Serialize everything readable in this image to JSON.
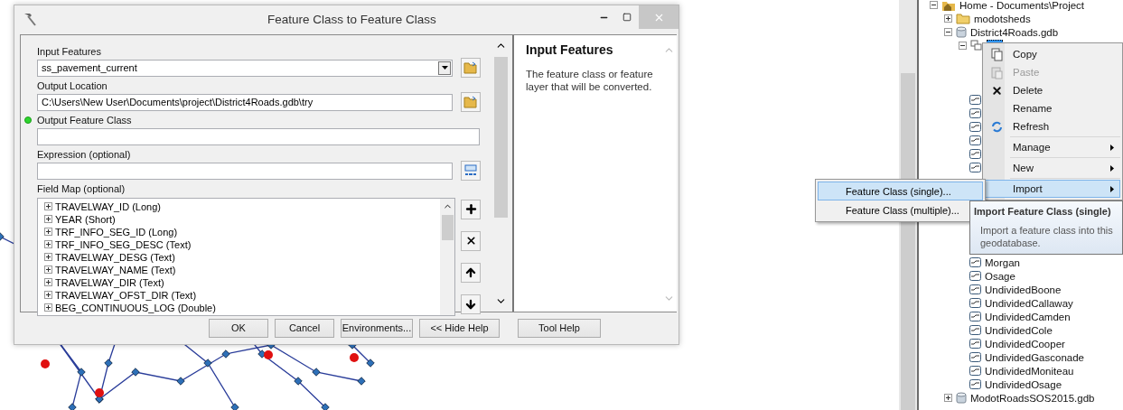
{
  "dialog": {
    "title": "Feature Class to Feature Class",
    "parameters": [
      {
        "kind": "combo",
        "label": "Input Features",
        "value": "ss_pavement_current",
        "flagged": false
      },
      {
        "kind": "path",
        "label": "Output Location",
        "value": "C:\\Users\\New User\\Documents\\project\\District4Roads.gdb\\try",
        "flagged": false
      },
      {
        "kind": "text",
        "label": "Output Feature Class",
        "flagged": true
      },
      {
        "kind": "expression",
        "label": "Expression (optional)",
        "flagged": false
      },
      {
        "kind": "fieldmap",
        "label": "Field Map (optional)",
        "fields": [
          "TRAVELWAY_ID (Long)",
          "YEAR (Short)",
          "TRF_INFO_SEG_ID (Long)",
          "TRF_INFO_SEG_DESC (Text)",
          "TRAVELWAY_DESG (Text)",
          "TRAVELWAY_NAME (Text)",
          "TRAVELWAY_DIR (Text)",
          "TRAVELWAY_OFST_DIR (Text)",
          "BEG_CONTINUOUS_LOG (Double)"
        ]
      }
    ],
    "help": {
      "title": "Input Features",
      "text": "The feature class or feature layer that will be converted."
    },
    "buttons": [
      "OK",
      "Cancel",
      "Environments...",
      "<< Hide Help"
    ],
    "help_button": "Tool Help"
  },
  "catalog_tree": [
    {
      "kind": "home",
      "name": "Home - Documents\\Project",
      "expanded": true,
      "selected": false,
      "children": [
        {
          "kind": "folder",
          "name": "modotsheds",
          "expanded": false,
          "selected": false
        },
        {
          "kind": "gdb",
          "name": "District4Roads.gdb",
          "expanded": true,
          "selected": false,
          "children": [
            {
              "kind": "dataset",
              "expanded": true,
              "selected": true,
              "children": [
                {
                  "kind": "featureclass",
                  "selected": false
                },
                {
                  "kind": "featureclass",
                  "selected": false
                },
                {
                  "kind": "featureclass",
                  "selected": false
                },
                {
                  "kind": "featureclass",
                  "selected": false
                },
                {
                  "kind": "featureclass",
                  "selected": false
                },
                {
                  "kind": "featureclass",
                  "selected": false
                },
                {
                  "kind": "featureclass",
                  "name": "Morgan",
                  "selected": false
                },
                {
                  "kind": "featureclass",
                  "name": "Osage",
                  "selected": false
                },
                {
                  "kind": "featureclass",
                  "name": "UndividedBoone",
                  "selected": false
                },
                {
                  "kind": "featureclass",
                  "name": "UndividedCallaway",
                  "selected": false
                },
                {
                  "kind": "featureclass",
                  "name": "UndividedCamden",
                  "selected": false
                },
                {
                  "kind": "featureclass",
                  "name": "UndividedCole",
                  "selected": false
                },
                {
                  "kind": "featureclass",
                  "name": "UndividedCooper",
                  "selected": false
                },
                {
                  "kind": "featureclass",
                  "name": "UndividedGasconade",
                  "selected": false
                },
                {
                  "kind": "featureclass",
                  "name": "UndividedMoniteau",
                  "selected": false
                },
                {
                  "kind": "featureclass",
                  "name": "UndividedOsage",
                  "selected": false
                }
              ]
            }
          ]
        },
        {
          "kind": "gdb",
          "name": "ModotRoadsSOS2015.gdb",
          "expanded": false,
          "selected": false
        }
      ]
    }
  ],
  "context_menu": [
    {
      "kind": "item",
      "label": "Copy",
      "disabled": false,
      "submenu": false,
      "selected": false
    },
    {
      "kind": "item",
      "label": "Paste",
      "disabled": true,
      "submenu": false,
      "selected": false
    },
    {
      "kind": "item",
      "label": "Delete",
      "disabled": false,
      "submenu": false,
      "selected": false
    },
    {
      "kind": "item",
      "label": "Rename",
      "disabled": false,
      "submenu": false,
      "selected": false
    },
    {
      "kind": "item",
      "label": "Refresh",
      "disabled": false,
      "submenu": false,
      "selected": false
    },
    {
      "kind": "separator"
    },
    {
      "kind": "item",
      "label": "Manage",
      "disabled": false,
      "submenu": true,
      "selected": false
    },
    {
      "kind": "separator"
    },
    {
      "kind": "item",
      "label": "New",
      "disabled": false,
      "submenu": true,
      "selected": false
    },
    {
      "kind": "separator"
    },
    {
      "kind": "item",
      "label": "Import",
      "disabled": false,
      "submenu": true,
      "selected": true
    }
  ],
  "submenu": [
    {
      "label": "Feature Class (single)...",
      "selected": true
    },
    {
      "label": "Feature Class (multiple)...",
      "selected": false
    }
  ],
  "tooltip": {
    "title": "Import Feature Class (single)",
    "text": "Import a feature class into this geodatabase."
  }
}
